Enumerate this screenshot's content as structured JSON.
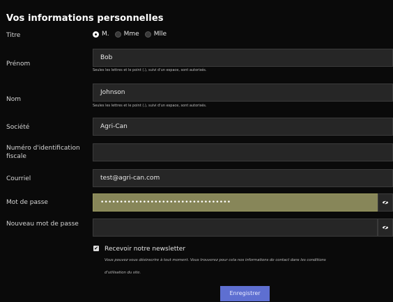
{
  "form": {
    "heading": "Vos informations personnelles",
    "title_label": "Titre",
    "title_options": [
      "M.",
      "Mme",
      "Mlle"
    ],
    "first_name_label": "Prénom",
    "first_name_value": "Bob",
    "first_name_hint": "Seules les lettres et le point (.), suivi d'un espace, sont autorisés.",
    "last_name_label": "Nom",
    "last_name_value": "Johnson",
    "last_name_hint": "Seules les lettres et le point (.), suivi d'un espace, sont autorisés.",
    "company_label": "Société",
    "company_value": "Agri-Can",
    "tax_id_label": "Numéro d'identification fiscale",
    "tax_id_value": "",
    "email_label": "Courriel",
    "email_value": "test@agri-can.com",
    "password_label": "Mot de passe",
    "password_value": "••••••••••••••••••••••••••••••••••",
    "new_password_label": "Nouveau mot de passe",
    "new_password_value": "",
    "newsletter_label": "Recevoir notre newsletter",
    "newsletter_note_line1": "Vous pouvez vous désinscrire à tout moment. Vous trouverez pour cela nos informations de contact dans les conditions",
    "newsletter_note_line2": "d'utilisation du site.",
    "submit_label": "Enregistrer",
    "checkbox_glyph": "✔"
  },
  "icons": {
    "show_password": "eye-slash-icon",
    "show_new_password": "eye-slash-icon"
  },
  "colors": {
    "background": "#0a0a0a",
    "field_bg": "#262626",
    "autofill_bg": "#878659",
    "button_bg": "#5e6fd1"
  }
}
